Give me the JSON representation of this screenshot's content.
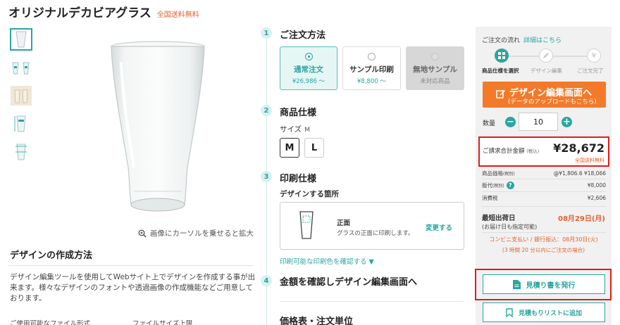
{
  "product": {
    "title": "オリジナルデカビアグラス",
    "free_shipping": "全国送料無料"
  },
  "gallery": {
    "zoom_hint": "画像にカーソルを乗せると拡大"
  },
  "howto": {
    "heading": "デザインの作成方法",
    "description": "デザイン編集ツールを使用してWebサイト上でデザインを作成する事が出来ます。様々なデザインのフォントや透過画像の作成機能などご用意しております。",
    "col1": "ご使用可能なファイル形式",
    "col2": "ファイルサイズ上限"
  },
  "steps": [
    {
      "num": "1",
      "title": "ご注文方法"
    },
    {
      "num": "2",
      "title": "商品仕様"
    },
    {
      "num": "3",
      "title": "印刷仕様"
    },
    {
      "num": "4",
      "title": "金額を確認しデザイン編集画面へ"
    }
  ],
  "order_methods": [
    {
      "label": "通常注文",
      "sub": "¥26,986 〜",
      "state": "selected"
    },
    {
      "label": "サンプル印刷",
      "sub": "¥8,800 〜",
      "state": "normal"
    },
    {
      "label": "無地サンプル",
      "sub": "未対応商品",
      "state": "disabled"
    }
  ],
  "spec": {
    "size_label": "サイズ",
    "size_current": "M",
    "sizes": [
      "M",
      "L"
    ]
  },
  "print": {
    "design_label": "デザインする箇所",
    "position_title": "正面",
    "position_desc": "グラスの正面に印刷します。",
    "change": "変更する",
    "color_link": "印刷可能な印刷色を確認する ▼"
  },
  "table_heading": "価格表・注文単位",
  "sidebar": {
    "flow_heading": "ご注文の流れ",
    "flow_link": "詳細はこちら",
    "flow_steps": [
      "商品仕様を選択",
      "デザイン編集",
      "ご注文完了"
    ],
    "design_button_l1": "デザイン編集画面へ",
    "design_button_l2": "(データのアップロードもこちら)",
    "qty_label": "数量",
    "qty_value": "10",
    "total_label": "ご請求合計金額",
    "total_tax": "(税込)",
    "total_value": "¥28,672",
    "total_free": "全国送料無料",
    "breakdown": [
      {
        "label": "商品価格",
        "note": "(税別)",
        "value": "@¥1,806.6 ¥18,066"
      },
      {
        "label": "版代",
        "note": "(税別)",
        "value": "¥8,000"
      },
      {
        "label": "消費税",
        "note": "",
        "value": "¥2,606"
      }
    ],
    "ship_label": "最短出荷日",
    "ship_sub": "(お届け日も指定可能)",
    "ship_date": "08月29日(月)",
    "conv_line1": "コンビニ支払い / 銀行振込：08月30日(火)",
    "conv_line2": "(3 時間 20 分以内にご注文の場合)",
    "estimate_button": "見積り書を発行",
    "wishlist_button": "見積もりリストに追加"
  },
  "colors": {
    "accent": "#2aa5a0",
    "orange": "#f27a2a",
    "highlight": "#e11b1b"
  }
}
